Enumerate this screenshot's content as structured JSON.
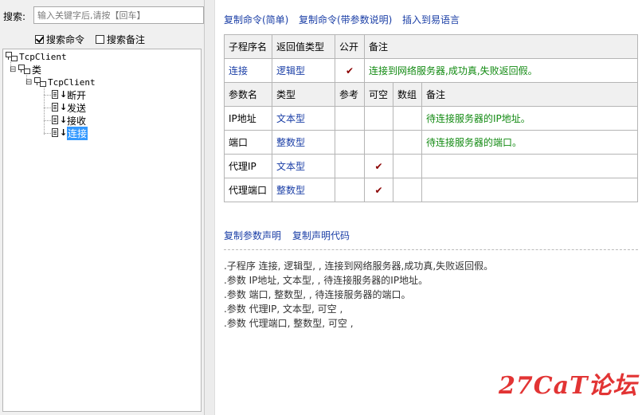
{
  "search": {
    "label": "搜索:",
    "placeholder": "输入关键字后,请按【回车】",
    "opt_commands": "搜索命令",
    "opt_notes": "搜索备注",
    "opt_commands_checked": true,
    "opt_notes_checked": false
  },
  "tree": {
    "root": "TcpClient",
    "category": "类",
    "class_name": "TcpClient",
    "methods": [
      "断开",
      "发送",
      "接收",
      "连接"
    ],
    "selected": "连接"
  },
  "toolbar": {
    "copy_simple": "复制命令(简单)",
    "copy_with_params": "复制命令(带参数说明)",
    "insert": "插入到易语言"
  },
  "sub": {
    "headers": [
      "子程序名",
      "返回值类型",
      "公开",
      "备注"
    ],
    "name": "连接",
    "return_type": "逻辑型",
    "public": "✔",
    "note": "连接到网络服务器,成功真,失败返回假。"
  },
  "params": {
    "headers": [
      "参数名",
      "类型",
      "参考",
      "可空",
      "数组",
      "备注"
    ],
    "rows": [
      {
        "name": "IP地址",
        "type": "文本型",
        "ref": "",
        "nullable": "",
        "array": "",
        "note": "待连接服务器的IP地址。"
      },
      {
        "name": "端口",
        "type": "整数型",
        "ref": "",
        "nullable": "",
        "array": "",
        "note": "待连接服务器的端口。"
      },
      {
        "name": "代理IP",
        "type": "文本型",
        "ref": "",
        "nullable": "✔",
        "array": "",
        "note": ""
      },
      {
        "name": "代理端口",
        "type": "整数型",
        "ref": "",
        "nullable": "✔",
        "array": "",
        "note": ""
      }
    ]
  },
  "bottom_links": {
    "copy_params": "复制参数声明",
    "copy_decl": "复制声明代码"
  },
  "declaration": [
    ".子程序 连接, 逻辑型, , 连接到网络服务器,成功真,失败返回假。",
    ".参数 IP地址, 文本型, , 待连接服务器的IP地址。",
    ".参数 端口, 整数型, , 待连接服务器的端口。",
    ".参数 代理IP, 文本型, 可空 ,",
    ".参数 代理端口, 整数型, 可空 ,"
  ],
  "watermark": "27CaT论坛",
  "colors": {
    "link": "#1a3ea6",
    "note_green": "#128a12",
    "check_red": "#8b0000",
    "selection": "#3399ff",
    "watermark": "#e23434"
  }
}
